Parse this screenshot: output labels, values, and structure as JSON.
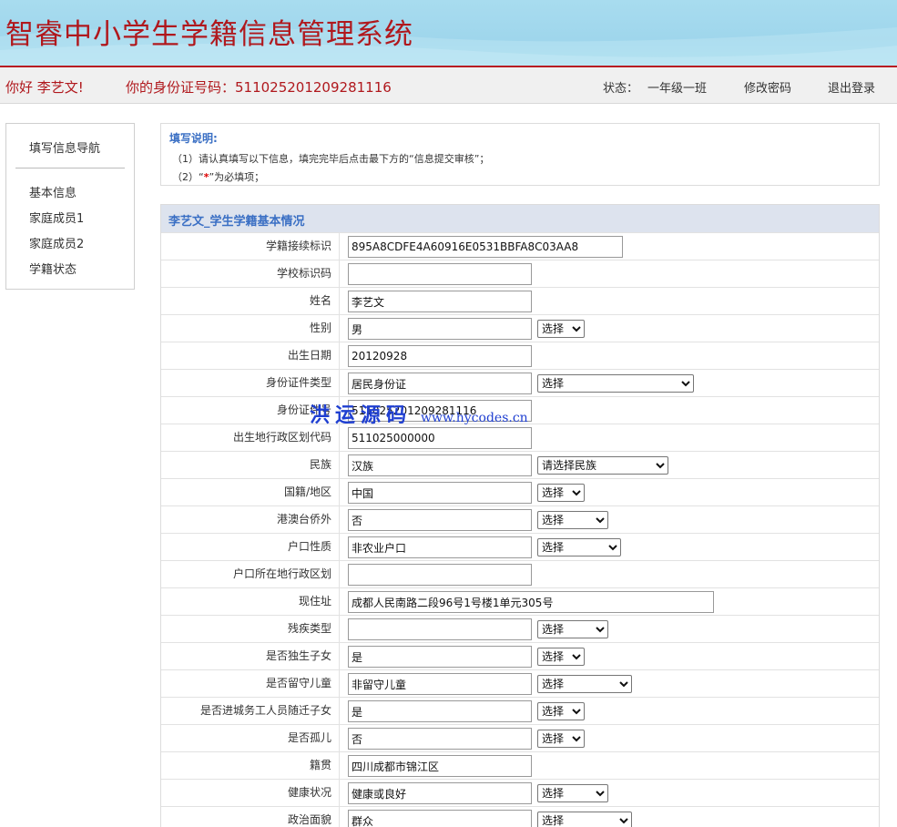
{
  "header": {
    "title": "智睿中小学生学籍信息管理系统"
  },
  "infobar": {
    "greeting": "你好 李艺文!",
    "id_text": "你的身份证号码：511025201209281116",
    "status_label": "状态：",
    "status_value": "一年级一班",
    "change_password": "修改密码",
    "logout": "退出登录"
  },
  "sidenav": {
    "title": "填写信息导航",
    "items": [
      {
        "label": "基本信息"
      },
      {
        "label": "家庭成员1"
      },
      {
        "label": "家庭成员2"
      },
      {
        "label": "学籍状态"
      }
    ]
  },
  "notes": {
    "title": "填写说明:",
    "line1": "（1）请认真填写以下信息，填完完毕后点击最下方的“信息提交审核”；",
    "line2_prefix": "（2）“",
    "line2_mark": "*",
    "line2_suffix": "”为必填项；"
  },
  "form": {
    "heading": "李艺文_学生学籍基本情况",
    "rows": [
      {
        "label": "学籍接续标识",
        "value": "895A8CDFE4A60916E0531BBFA8C03AA8"
      },
      {
        "label": "学校标识码",
        "value": ""
      },
      {
        "label": "姓名",
        "value": "李艺文"
      },
      {
        "label": "性别",
        "value": "男",
        "select": "选择"
      },
      {
        "label": "出生日期",
        "value": "20120928"
      },
      {
        "label": "身份证件类型",
        "value": "居民身份证",
        "select": "选择"
      },
      {
        "label": "身份证件号",
        "value": "511025201209281116"
      },
      {
        "label": "出生地行政区划代码",
        "value": "511025000000"
      },
      {
        "label": "民族",
        "value": "汉族",
        "select": "请选择民族"
      },
      {
        "label": "国籍/地区",
        "value": "中国",
        "select": "选择"
      },
      {
        "label": "港澳台侨外",
        "value": "否",
        "select": "选择"
      },
      {
        "label": "户口性质",
        "value": "非农业户口",
        "select": "选择"
      },
      {
        "label": "户口所在地行政区划",
        "value": ""
      },
      {
        "label": "现住址",
        "value": "成都人民南路二段96号1号楼1单元305号"
      },
      {
        "label": "残疾类型",
        "value": "",
        "select": "选择"
      },
      {
        "label": "是否独生子女",
        "value": "是",
        "select": "选择"
      },
      {
        "label": "是否留守儿童",
        "value": "非留守儿童",
        "select": "选择"
      },
      {
        "label": "是否进城务工人员随迁子女",
        "value": "是",
        "select": "选择"
      },
      {
        "label": "是否孤儿",
        "value": "否",
        "select": "选择"
      },
      {
        "label": "籍贯",
        "value": "四川成都市锦江区"
      },
      {
        "label": "健康状况",
        "value": "健康或良好",
        "select": "选择"
      },
      {
        "label": "政治面貌",
        "value": "群众",
        "select": "选择"
      }
    ]
  },
  "watermark": {
    "text": "洪运源码",
    "url": "www.hycodes.cn"
  }
}
